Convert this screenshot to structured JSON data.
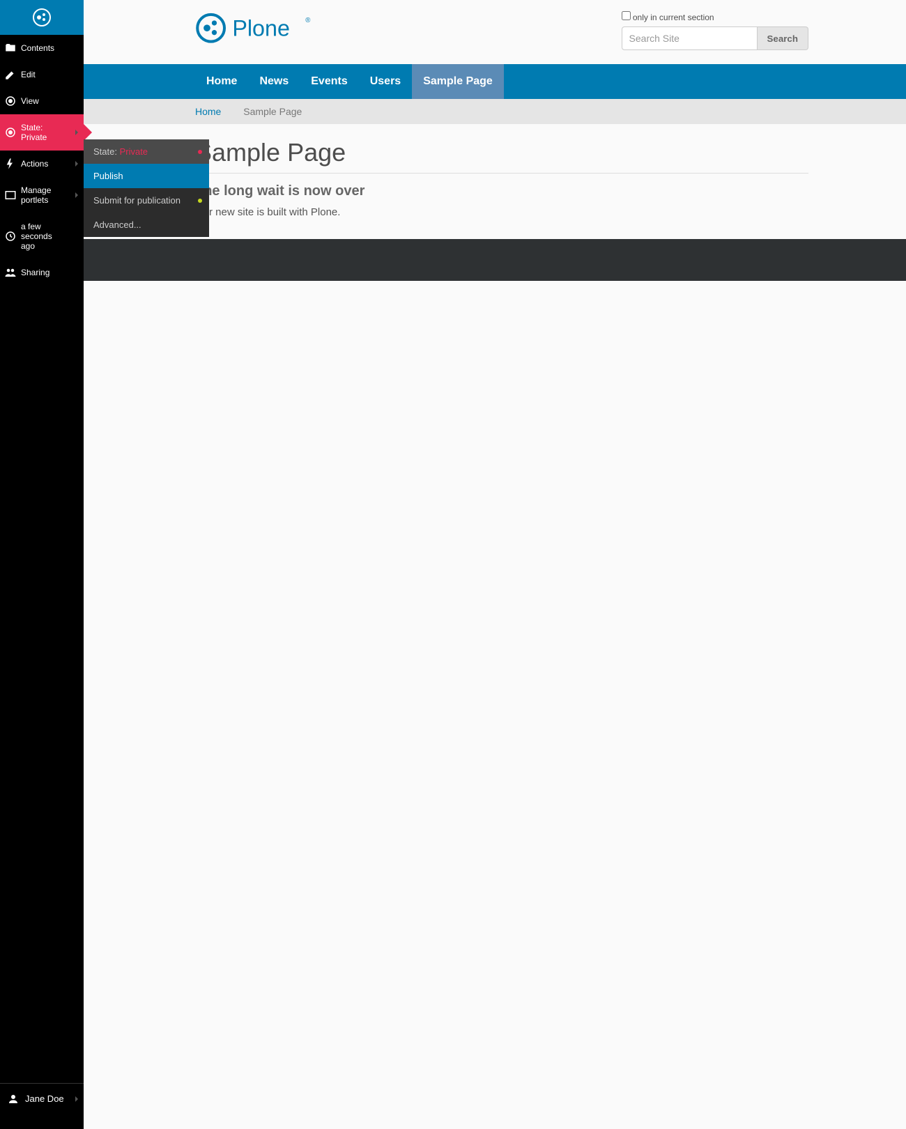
{
  "toolbar": {
    "items": [
      {
        "label": "Contents"
      },
      {
        "label": "Edit"
      },
      {
        "label": "View"
      },
      {
        "state_label": "State:",
        "state_value": "Private"
      },
      {
        "label": "Actions"
      },
      {
        "label_top": "Manage",
        "label_bottom": "portlets"
      },
      {
        "label_top": "a few",
        "label_mid": "seconds",
        "label_bottom": "ago"
      },
      {
        "label": "Sharing"
      }
    ],
    "user_label": "Jane Doe"
  },
  "flyout": {
    "header_prefix": "State: ",
    "header_value": "Private",
    "items": [
      {
        "label": "Publish"
      },
      {
        "label": "Submit for publication"
      },
      {
        "label": "Advanced..."
      }
    ]
  },
  "search": {
    "only_label": "only in current section",
    "placeholder": "Search Site",
    "button": "Search"
  },
  "globalnav": [
    {
      "label": "Home"
    },
    {
      "label": "News"
    },
    {
      "label": "Events"
    },
    {
      "label": "Users"
    },
    {
      "label": "Sample Page",
      "selected": true
    }
  ],
  "breadcrumb": {
    "home": "Home",
    "current": "Sample Page"
  },
  "doc": {
    "title": "Sample Page",
    "subtitle": "The long wait is now over",
    "body": "Our new site is built with Plone."
  }
}
